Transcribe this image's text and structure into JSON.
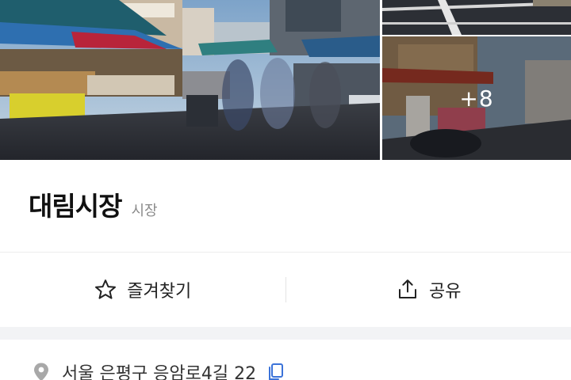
{
  "gallery": {
    "more_count_label": "+8"
  },
  "place": {
    "name": "대림시장",
    "category": "시장"
  },
  "actions": {
    "favorite_label": "즐겨찾기",
    "share_label": "공유"
  },
  "address": {
    "text": "서울 은평구 응암로4길 22"
  },
  "colors": {
    "name_text": "#111111",
    "category_text": "#8a8a8a",
    "section_band": "#f2f3f5",
    "icon_stroke": "#222222"
  },
  "icons": {
    "favorite": "star-outline-icon",
    "share": "share-icon",
    "location": "location-pin-icon",
    "copy": "copy-icon"
  }
}
